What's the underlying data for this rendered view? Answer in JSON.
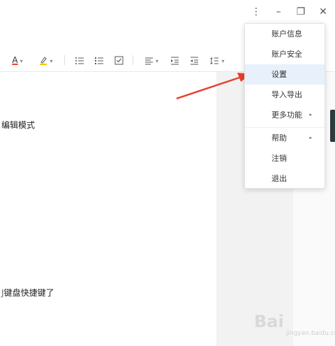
{
  "window_controls": {
    "more_glyph": "⋮",
    "minimize_glyph": "–",
    "restore_glyph": "❐",
    "close_glyph": "✕"
  },
  "toolbar": {
    "font_color_label": "A",
    "caret": "▾"
  },
  "document": {
    "line1": "编辑模式",
    "line2": "盘快捷键了",
    "line2_prefix": "键",
    "line2_cut": "J"
  },
  "menu": {
    "items": [
      {
        "label": "账户信息"
      },
      {
        "label": "账户安全"
      },
      {
        "label": "设置"
      },
      {
        "label": "导入导出"
      },
      {
        "label": "更多功能",
        "arrow": "▸"
      },
      {
        "label": "帮助",
        "arrow": "▸"
      },
      {
        "label": "注销"
      },
      {
        "label": "退出"
      }
    ]
  },
  "watermark": {
    "text": "Bai",
    "sub": "jingyan.baidu.com"
  },
  "colors": {
    "accent_arrow": "#e8402e",
    "menu_active_bg": "#e8f1fb",
    "side_tab": "#2e3b3b"
  }
}
